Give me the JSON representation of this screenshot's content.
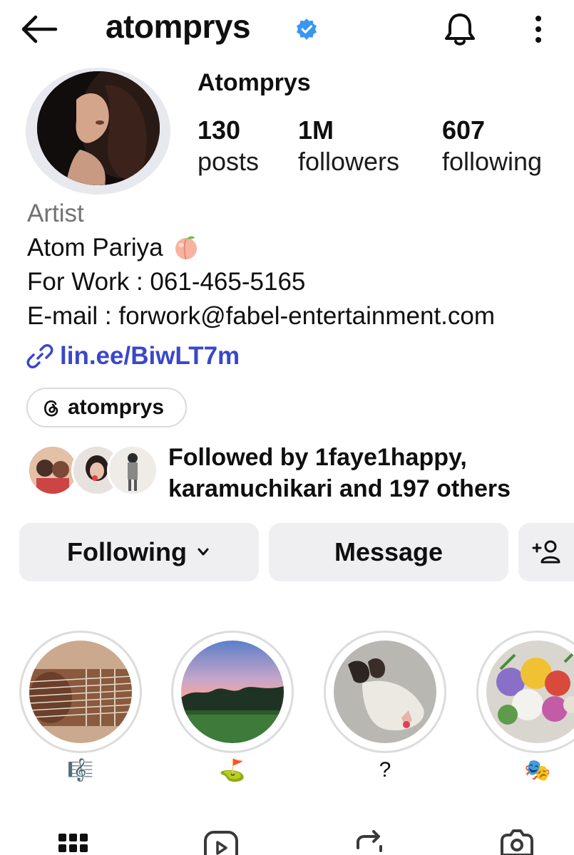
{
  "header": {
    "username": "atomprys",
    "back_icon": "arrow-left-icon",
    "verified_icon": "verified-badge-icon",
    "notifications_icon": "bell-icon",
    "more_icon": "more-vertical-icon"
  },
  "profile": {
    "display_name": "Atomprys",
    "stats": [
      {
        "value": "130",
        "label": "posts"
      },
      {
        "value": "1M",
        "label": "followers"
      },
      {
        "value": "607",
        "label": "following"
      }
    ]
  },
  "bio": {
    "category": "Artist",
    "name_line": "Atom Pariya",
    "name_emoji": "peach-emoji",
    "work_line": "For Work : 061-465-5165",
    "email_line": "E-mail : forwork@fabel-entertainment.com",
    "link": "lin.ee/BiwLT7m",
    "link_icon": "link-icon"
  },
  "threads": {
    "handle": "atomprys",
    "icon": "threads-icon"
  },
  "followed_by": {
    "line1": "Followed by 1faye1happy,",
    "line2": "karamuchikari and 197 others"
  },
  "actions": {
    "following_label": "Following",
    "message_label": "Message",
    "add_user_icon": "add-person-icon"
  },
  "highlights": [
    {
      "label": "🎼",
      "cover": "guitar"
    },
    {
      "label": "⛳",
      "cover": "sunset-golf-course"
    },
    {
      "label": "?",
      "cover": "shoes"
    },
    {
      "label": "🎭",
      "cover": "flowers"
    }
  ],
  "tabs": [
    "grid-icon",
    "reels-icon",
    "reposts-icon",
    "tagged-icon"
  ],
  "colors": {
    "link": "#3a47c9",
    "verified": "#3897f0",
    "button_bg": "#efeff2",
    "muted_text": "#737373"
  }
}
